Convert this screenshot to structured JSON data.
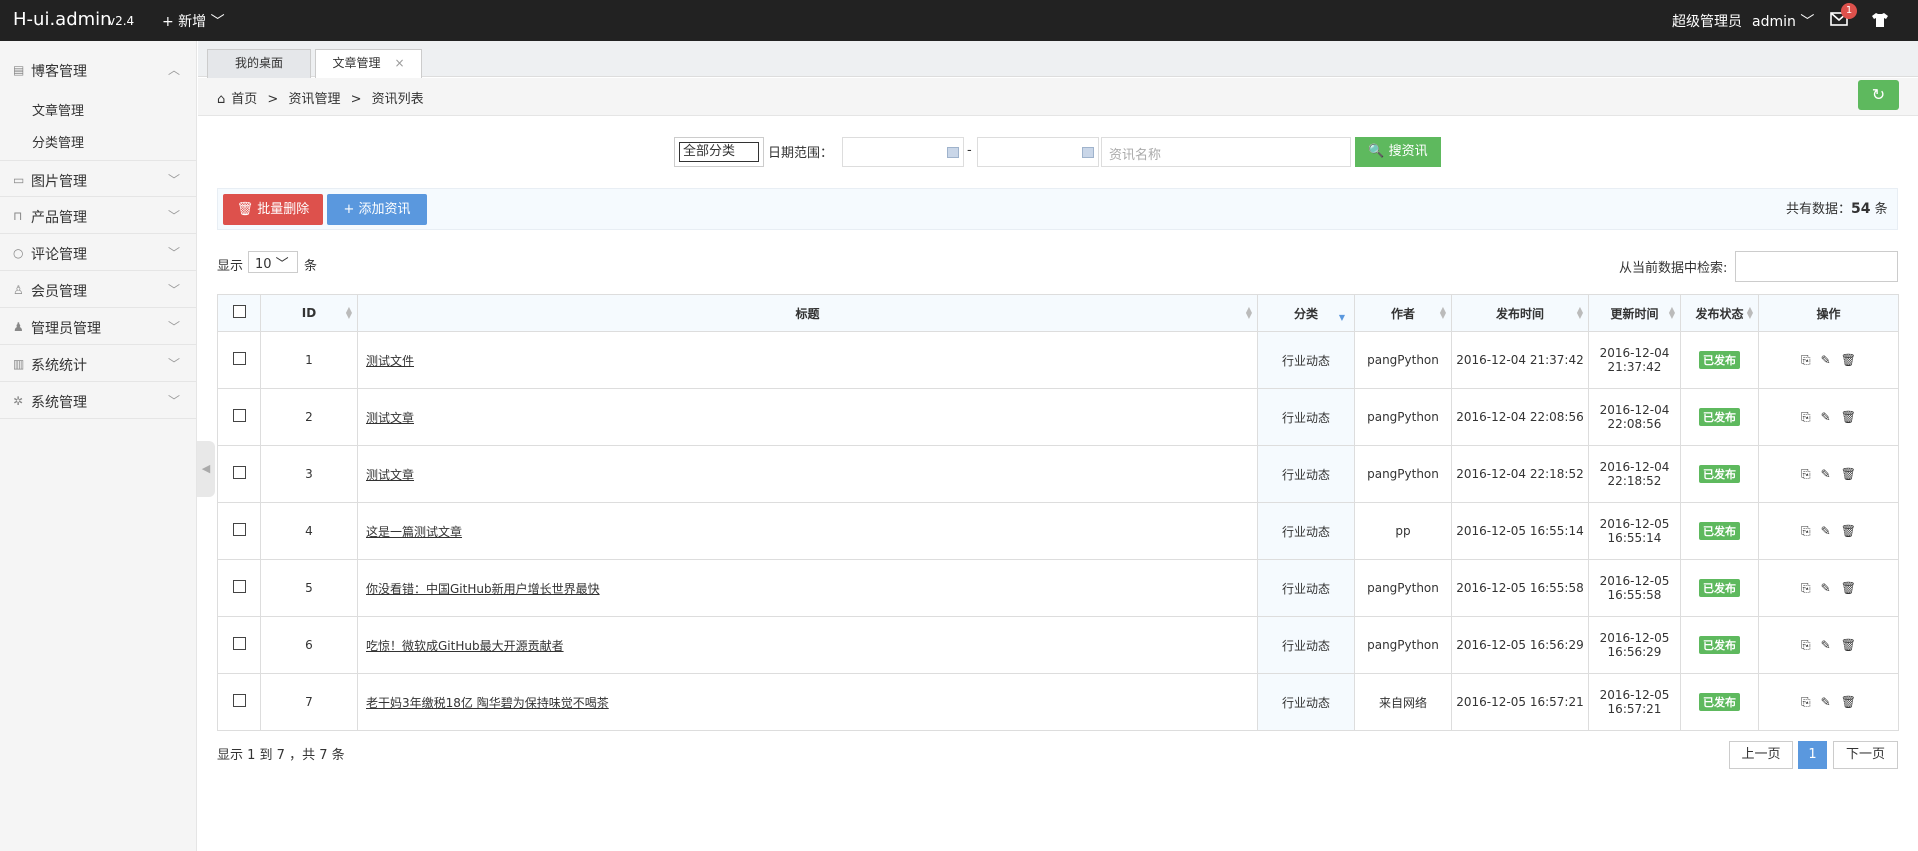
{
  "header": {
    "logo": "H-ui.admin",
    "version": "v2.4",
    "new_label": "+ 新增 ﹀",
    "role": "超级管理员",
    "username": "admin ﹀",
    "mail_badge": "1"
  },
  "sidebar": {
    "menus": [
      {
        "label": "博客管理",
        "icon": "book-icon",
        "chevron": "︿"
      },
      {
        "label": "图片管理",
        "icon": "image-icon",
        "chevron": "﹀"
      },
      {
        "label": "产品管理",
        "icon": "bag-icon",
        "chevron": "﹀"
      },
      {
        "label": "评论管理",
        "icon": "comment-icon",
        "chevron": "﹀"
      },
      {
        "label": "会员管理",
        "icon": "user-icon",
        "chevron": "﹀"
      },
      {
        "label": "管理员管理",
        "icon": "admin-icon",
        "chevron": "﹀"
      },
      {
        "label": "系统统计",
        "icon": "chart-icon",
        "chevron": "﹀"
      },
      {
        "label": "系统管理",
        "icon": "gear-icon",
        "chevron": "﹀"
      }
    ],
    "sub_items": [
      "文章管理",
      "分类管理"
    ],
    "collapse_glyph": "◀"
  },
  "tabs": [
    {
      "label": "我的桌面",
      "close": ""
    },
    {
      "label": "文章管理",
      "close": "×"
    }
  ],
  "breadcrumb": {
    "home": "首页",
    "sep": ">",
    "level2": "资讯管理",
    "level3": "资讯列表",
    "home_icon": "⌂"
  },
  "refresh_icon": "↻",
  "search": {
    "category_value": "全部分类",
    "date_label": "日期范围：",
    "date_sep": "-",
    "name_placeholder": "资讯名称",
    "search_label": "🔍 搜资讯"
  },
  "actions": {
    "delete_label": "🗑 批量删除",
    "add_label": "+ 添加资讯",
    "total_prefix": "共有数据：",
    "total_count": "54",
    "total_suffix": " 条"
  },
  "table_controls": {
    "show_label": "显示",
    "page_size": "10 ﹀",
    "show_unit": "条",
    "filter_label": "从当前数据中检索:"
  },
  "table": {
    "headers": [
      "ID",
      "标题",
      "分类",
      "作者",
      "发布时间",
      "更新时间",
      "发布状态",
      "操作"
    ],
    "rows": [
      {
        "id": "1",
        "title": "测试文件",
        "cat": "行业动态",
        "author": "pangPython",
        "pub": "2016-12-04 21:37:42",
        "upd1": "2016-12-04",
        "upd2": "21:37:42",
        "status": "已发布"
      },
      {
        "id": "2",
        "title": "测试文章",
        "cat": "行业动态",
        "author": "pangPython",
        "pub": "2016-12-04 22:08:56",
        "upd1": "2016-12-04",
        "upd2": "22:08:56",
        "status": "已发布"
      },
      {
        "id": "3",
        "title": "测试文章",
        "cat": "行业动态",
        "author": "pangPython",
        "pub": "2016-12-04 22:18:52",
        "upd1": "2016-12-04",
        "upd2": "22:18:52",
        "status": "已发布"
      },
      {
        "id": "4",
        "title": "这是一篇测试文章",
        "cat": "行业动态",
        "author": "pp",
        "pub": "2016-12-05 16:55:14",
        "upd1": "2016-12-05",
        "upd2": "16:55:14",
        "status": "已发布"
      },
      {
        "id": "5",
        "title": "你没看错：中国GitHub新用户增长世界最快",
        "cat": "行业动态",
        "author": "pangPython",
        "pub": "2016-12-05 16:55:58",
        "upd1": "2016-12-05",
        "upd2": "16:55:58",
        "status": "已发布"
      },
      {
        "id": "6",
        "title": "吃惊！微软成GitHub最大开源贡献者",
        "cat": "行业动态",
        "author": "pangPython",
        "pub": "2016-12-05 16:56:29",
        "upd1": "2016-12-05",
        "upd2": "16:56:29",
        "status": "已发布"
      },
      {
        "id": "7",
        "title": "老干妈3年缴税18亿 陶华碧为保持味觉不喝茶",
        "cat": "行业动态",
        "author": "来自网络",
        "pub": "2016-12-05 16:57:21",
        "upd1": "2016-12-05",
        "upd2": "16:57:21",
        "status": "已发布"
      }
    ],
    "op_icons": [
      "⎘",
      "✎",
      "🗑"
    ]
  },
  "footer": {
    "info": "显示 1 到 7 ，共 7 条",
    "prev": "上一页",
    "current": "1",
    "next": "下一页"
  }
}
